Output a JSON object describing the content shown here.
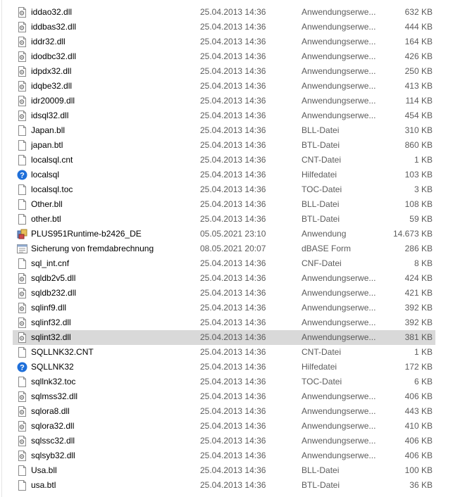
{
  "files": [
    {
      "name": "iddao32.dll",
      "date": "25.04.2013 14:36",
      "type": "Anwendungserwe...",
      "size": "632 KB",
      "icon": "dll-file-icon"
    },
    {
      "name": "iddbas32.dll",
      "date": "25.04.2013 14:36",
      "type": "Anwendungserwe...",
      "size": "444 KB",
      "icon": "dll-file-icon"
    },
    {
      "name": "iddr32.dll",
      "date": "25.04.2013 14:36",
      "type": "Anwendungserwe...",
      "size": "164 KB",
      "icon": "dll-file-icon"
    },
    {
      "name": "idodbc32.dll",
      "date": "25.04.2013 14:36",
      "type": "Anwendungserwe...",
      "size": "426 KB",
      "icon": "dll-file-icon"
    },
    {
      "name": "idpdx32.dll",
      "date": "25.04.2013 14:36",
      "type": "Anwendungserwe...",
      "size": "250 KB",
      "icon": "dll-file-icon"
    },
    {
      "name": "idqbe32.dll",
      "date": "25.04.2013 14:36",
      "type": "Anwendungserwe...",
      "size": "413 KB",
      "icon": "dll-file-icon"
    },
    {
      "name": "idr20009.dll",
      "date": "25.04.2013 14:36",
      "type": "Anwendungserwe...",
      "size": "114 KB",
      "icon": "dll-file-icon"
    },
    {
      "name": "idsql32.dll",
      "date": "25.04.2013 14:36",
      "type": "Anwendungserwe...",
      "size": "454 KB",
      "icon": "dll-file-icon"
    },
    {
      "name": "Japan.bll",
      "date": "25.04.2013 14:36",
      "type": "BLL-Datei",
      "size": "310 KB",
      "icon": "blank-file-icon"
    },
    {
      "name": "japan.btl",
      "date": "25.04.2013 14:36",
      "type": "BTL-Datei",
      "size": "860 KB",
      "icon": "blank-file-icon"
    },
    {
      "name": "localsql.cnt",
      "date": "25.04.2013 14:36",
      "type": "CNT-Datei",
      "size": "1 KB",
      "icon": "blank-file-icon"
    },
    {
      "name": "localsql",
      "date": "25.04.2013 14:36",
      "type": "Hilfedatei",
      "size": "103 KB",
      "icon": "help-file-icon"
    },
    {
      "name": "localsql.toc",
      "date": "25.04.2013 14:36",
      "type": "TOC-Datei",
      "size": "3 KB",
      "icon": "blank-file-icon"
    },
    {
      "name": "Other.bll",
      "date": "25.04.2013 14:36",
      "type": "BLL-Datei",
      "size": "108 KB",
      "icon": "blank-file-icon"
    },
    {
      "name": "other.btl",
      "date": "25.04.2013 14:36",
      "type": "BTL-Datei",
      "size": "59 KB",
      "icon": "blank-file-icon"
    },
    {
      "name": "PLUS951Runtime-b2426_DE",
      "date": "05.05.2021 23:10",
      "type": "Anwendung",
      "size": "14.673 KB",
      "icon": "installer-icon"
    },
    {
      "name": "Sicherung von fremdabrechnung",
      "date": "08.05.2021 20:07",
      "type": "dBASE Form",
      "size": "286 KB",
      "icon": "form-file-icon"
    },
    {
      "name": "sql_int.cnf",
      "date": "25.04.2013 14:36",
      "type": "CNF-Datei",
      "size": "8 KB",
      "icon": "blank-file-icon"
    },
    {
      "name": "sqldb2v5.dll",
      "date": "25.04.2013 14:36",
      "type": "Anwendungserwe...",
      "size": "424 KB",
      "icon": "dll-file-icon"
    },
    {
      "name": "sqldb232.dll",
      "date": "25.04.2013 14:36",
      "type": "Anwendungserwe...",
      "size": "421 KB",
      "icon": "dll-file-icon"
    },
    {
      "name": "sqlinf9.dll",
      "date": "25.04.2013 14:36",
      "type": "Anwendungserwe...",
      "size": "392 KB",
      "icon": "dll-file-icon"
    },
    {
      "name": "sqlinf32.dll",
      "date": "25.04.2013 14:36",
      "type": "Anwendungserwe...",
      "size": "392 KB",
      "icon": "dll-file-icon"
    },
    {
      "name": "sqlint32.dll",
      "date": "25.04.2013 14:36",
      "type": "Anwendungserwe...",
      "size": "381 KB",
      "icon": "dll-file-icon",
      "selected": true
    },
    {
      "name": "SQLLNK32.CNT",
      "date": "25.04.2013 14:36",
      "type": "CNT-Datei",
      "size": "1 KB",
      "icon": "blank-file-icon"
    },
    {
      "name": "SQLLNK32",
      "date": "25.04.2013 14:36",
      "type": "Hilfedatei",
      "size": "172 KB",
      "icon": "help-file-icon"
    },
    {
      "name": "sqllnk32.toc",
      "date": "25.04.2013 14:36",
      "type": "TOC-Datei",
      "size": "6 KB",
      "icon": "blank-file-icon"
    },
    {
      "name": "sqlmss32.dll",
      "date": "25.04.2013 14:36",
      "type": "Anwendungserwe...",
      "size": "406 KB",
      "icon": "dll-file-icon"
    },
    {
      "name": "sqlora8.dll",
      "date": "25.04.2013 14:36",
      "type": "Anwendungserwe...",
      "size": "443 KB",
      "icon": "dll-file-icon"
    },
    {
      "name": "sqlora32.dll",
      "date": "25.04.2013 14:36",
      "type": "Anwendungserwe...",
      "size": "410 KB",
      "icon": "dll-file-icon"
    },
    {
      "name": "sqlssc32.dll",
      "date": "25.04.2013 14:36",
      "type": "Anwendungserwe...",
      "size": "406 KB",
      "icon": "dll-file-icon"
    },
    {
      "name": "sqlsyb32.dll",
      "date": "25.04.2013 14:36",
      "type": "Anwendungserwe...",
      "size": "406 KB",
      "icon": "dll-file-icon"
    },
    {
      "name": "Usa.bll",
      "date": "25.04.2013 14:36",
      "type": "BLL-Datei",
      "size": "100 KB",
      "icon": "blank-file-icon"
    },
    {
      "name": "usa.btl",
      "date": "25.04.2013 14:36",
      "type": "BTL-Datei",
      "size": "36 KB",
      "icon": "blank-file-icon"
    }
  ],
  "colors": {
    "selected_row": "#d9d9d9",
    "secondary_text": "#5c5c5c",
    "help_icon": "#1e6fd9"
  }
}
